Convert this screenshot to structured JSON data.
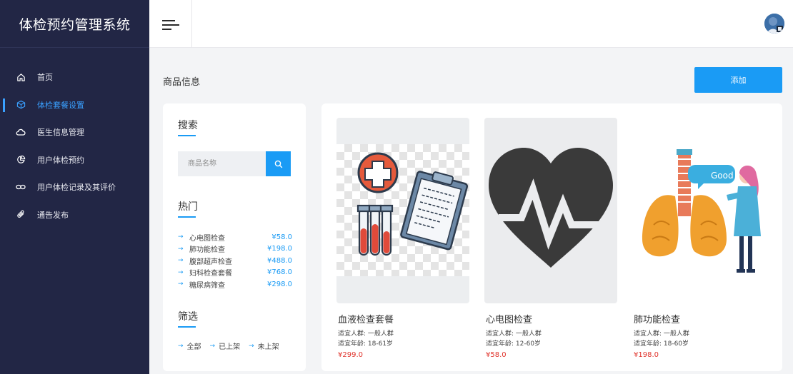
{
  "app": {
    "title": "体检预约管理系统"
  },
  "sidebar": {
    "items": [
      {
        "label": "首页",
        "icon": "home-icon",
        "active": false
      },
      {
        "label": "体检套餐设置",
        "icon": "cube-icon",
        "active": true
      },
      {
        "label": "医生信息管理",
        "icon": "cloud-icon",
        "active": false
      },
      {
        "label": "用户体检预约",
        "icon": "pie-chart-icon",
        "active": false
      },
      {
        "label": "用户体检记录及其评价",
        "icon": "link-icon",
        "active": false
      },
      {
        "label": "通告发布",
        "icon": "paperclip-icon",
        "active": false
      }
    ]
  },
  "header": {
    "menu_icon": "hamburger-icon",
    "avatar_icon": "user-avatar-icon"
  },
  "main": {
    "title": "商品信息",
    "add_label": "添加",
    "search": {
      "title": "搜索",
      "placeholder": "商品名称"
    },
    "hot": {
      "title": "热门",
      "items": [
        {
          "name": "心电图检查",
          "price": "¥58.0"
        },
        {
          "name": "肺功能检查",
          "price": "¥198.0"
        },
        {
          "name": "腹部超声检查",
          "price": "¥488.0"
        },
        {
          "name": "妇科检查套餐",
          "price": "¥768.0"
        },
        {
          "name": "糖尿病筛查",
          "price": "¥298.0"
        }
      ]
    },
    "filter": {
      "title": "筛选",
      "options": [
        {
          "label": "全部"
        },
        {
          "label": "已上架"
        },
        {
          "label": "未上架"
        }
      ]
    },
    "products": [
      {
        "title": "血液检查套餐",
        "crowd": "适宜人群: 一般人群",
        "age": "适宜年龄: 18-61岁",
        "price": "¥299.0",
        "image_icon": "blood-test-tubes-clipboard-icon"
      },
      {
        "title": "心电图检查",
        "crowd": "适宜人群: 一般人群",
        "age": "适宜年龄: 12-60岁",
        "price": "¥58.0",
        "image_icon": "heart-pulse-icon"
      },
      {
        "title": "肺功能检查",
        "crowd": "适宜人群: 一般人群",
        "age": "适宜年龄: 18-60岁",
        "price": "¥198.0",
        "image_icon": "lungs-doctor-icon"
      }
    ]
  },
  "colors": {
    "sidebar_bg": "#222645",
    "accent": "#1a9bf5",
    "price_red": "#e0342c"
  }
}
